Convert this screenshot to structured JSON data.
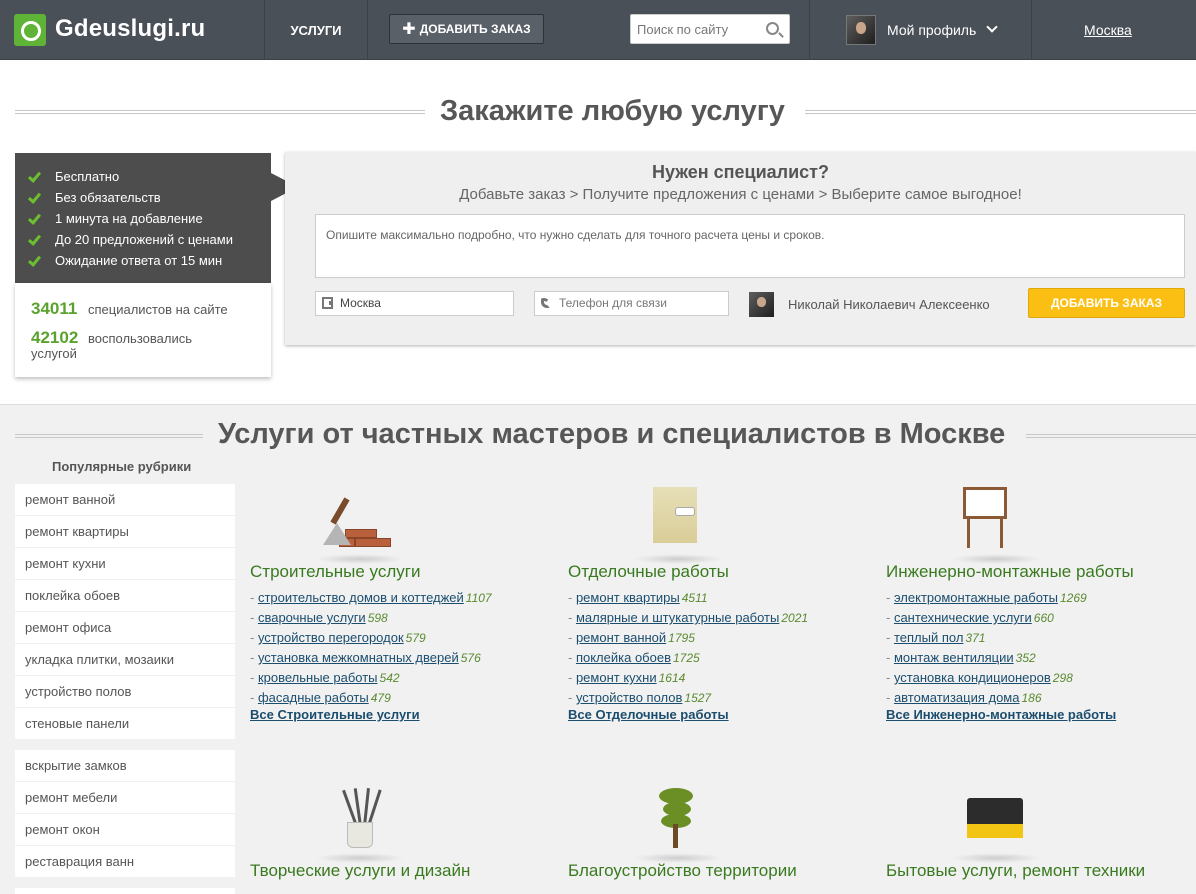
{
  "header": {
    "logo_text": "Gdeuslugi.ru",
    "nav_services": "УСЛУГИ",
    "add_order_label": "ДОБАВИТЬ ЗАКАЗ",
    "search_placeholder": "Поиск по сайту",
    "profile_label": "Мой профиль",
    "city": "Москва"
  },
  "order_section": {
    "title": "Закажите любую услугу",
    "features": [
      "Бесплатно",
      "Без обязательств",
      "1 минута на добавление",
      "До 20 предложений с ценами",
      "Ожидание ответа от 15 мин"
    ],
    "stats": [
      {
        "number": "34011",
        "text": "специалистов на сайте"
      },
      {
        "number": "42102",
        "text": "воспользовались",
        "text2": "услугой"
      }
    ],
    "panel_title": "Нужен специалист?",
    "panel_subtitle": "Добавьте заказ > Получите предложения с ценами > Выберите самое выгодное!",
    "textarea_placeholder": "Опишите максимально подробно, что нужно сделать для точного расчета цены и сроков.",
    "city_value": "Москва",
    "phone_placeholder": "Телефон для связи",
    "user_name": "Николай Николаевич Алексеенко",
    "submit_label": "ДОБАВИТЬ ЗАКАЗ"
  },
  "services_section": {
    "title": "Услуги от частных мастеров и специалистов в Москве",
    "rubrics_title": "Популярные рубрики",
    "rubrics_group1": [
      "ремонт ванной",
      "ремонт квартиры",
      "ремонт кухни",
      "поклейка обоев",
      "ремонт офиса",
      "укладка плитки, мозаики",
      "устройство полов",
      "стеновые панели"
    ],
    "rubrics_group2": [
      "вскрытие замков",
      "ремонт мебели",
      "ремонт окон",
      "реставрация ванн"
    ],
    "categories": [
      {
        "title": "Строительные услуги",
        "links": [
          {
            "name": "строительство домов и коттеджей",
            "count": "1107"
          },
          {
            "name": "сварочные услуги",
            "count": "598"
          },
          {
            "name": "устройство перегородок",
            "count": "579"
          },
          {
            "name": "установка межкомнатных дверей",
            "count": "576"
          },
          {
            "name": "кровельные работы",
            "count": "542"
          },
          {
            "name": "фасадные работы",
            "count": "479"
          }
        ],
        "all_label": "Все Строительные услуги"
      },
      {
        "title": "Отделочные работы",
        "links": [
          {
            "name": "ремонт квартиры",
            "count": "4511"
          },
          {
            "name": "малярные и штукатурные работы",
            "count": "2021"
          },
          {
            "name": "ремонт ванной",
            "count": "1795"
          },
          {
            "name": "поклейка обоев",
            "count": "1725"
          },
          {
            "name": "ремонт кухни",
            "count": "1614"
          },
          {
            "name": "устройство полов",
            "count": "1527"
          }
        ],
        "all_label": "Все Отделочные работы"
      },
      {
        "title": "Инженерно-монтажные работы",
        "links": [
          {
            "name": "электромонтажные работы",
            "count": "1269"
          },
          {
            "name": "сантехнические услуги",
            "count": "660"
          },
          {
            "name": "теплый пол",
            "count": "371"
          },
          {
            "name": "монтаж вентиляции",
            "count": "352"
          },
          {
            "name": "установка кондиционеров",
            "count": "298"
          },
          {
            "name": "автоматизация дома",
            "count": "186"
          }
        ],
        "all_label": "Все Инженерно-монтажные работы"
      },
      {
        "title": "Творческие услуги и дизайн"
      },
      {
        "title": "Благоустройство территории"
      },
      {
        "title": "Бытовые услуги, ремонт техники"
      }
    ]
  },
  "icons": {
    "logo": "logo-icon",
    "plus": "plus-icon",
    "search": "search-icon",
    "avatar": "avatar",
    "chevron": "chevron-down-icon",
    "check": "check-icon",
    "building": "building-icon",
    "phone": "phone-icon"
  },
  "colors": {
    "header_bg": "#4a5058",
    "accent_green": "#5aa22d",
    "submit_yellow": "#fbbf14",
    "link_blue": "#1b4d6e"
  }
}
